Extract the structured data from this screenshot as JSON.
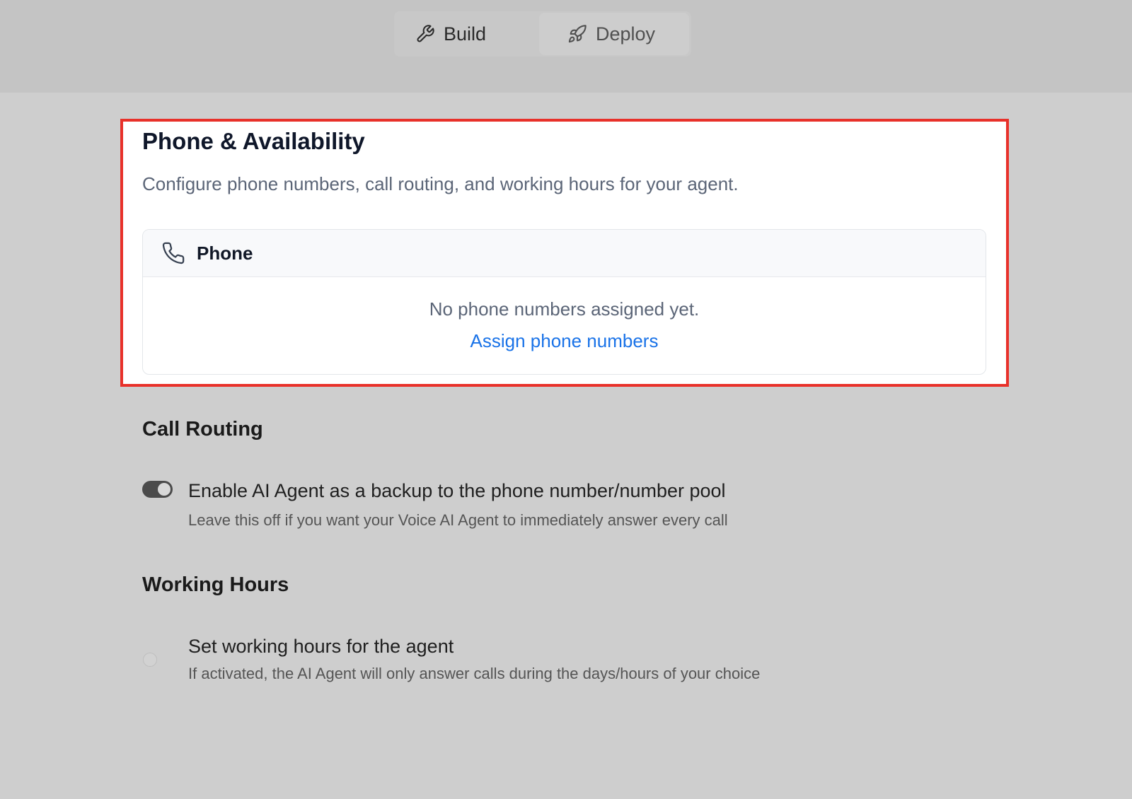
{
  "tabs": {
    "build": {
      "label": "Build",
      "icon": "wrench-icon"
    },
    "deploy": {
      "label": "Deploy",
      "icon": "rocket-icon"
    }
  },
  "phone_availability": {
    "title": "Phone & Availability",
    "description": "Configure phone numbers, call routing, and working hours for your agent.",
    "phone_card": {
      "title": "Phone",
      "icon": "phone-icon",
      "empty_text": "No phone numbers assigned yet.",
      "assign_link": "Assign phone numbers"
    }
  },
  "call_routing": {
    "title": "Call Routing",
    "backup_toggle": {
      "enabled": true,
      "label": "Enable AI Agent as a backup to the phone number/number pool",
      "help": "Leave this off if you want your Voice AI Agent to immediately answer every call"
    }
  },
  "working_hours": {
    "title": "Working Hours",
    "hours_toggle": {
      "enabled": false,
      "label": "Set working hours for the agent",
      "help": "If activated, the AI Agent will only answer calls during the days/hours of your choice"
    }
  },
  "colors": {
    "highlight_border": "#e8312a",
    "link": "#1a73e8",
    "toggle_on": "#4b4b4b"
  }
}
